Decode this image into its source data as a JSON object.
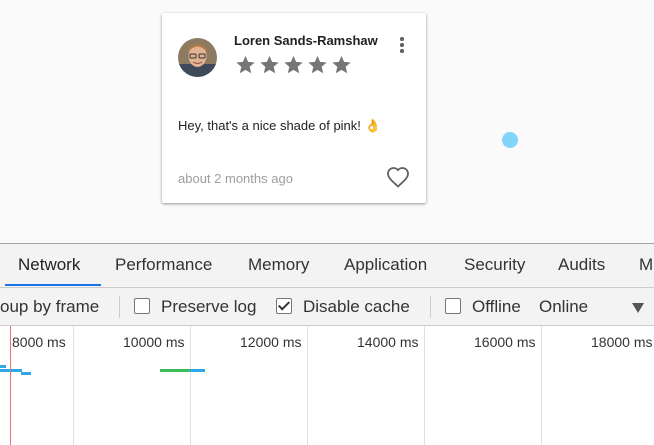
{
  "card": {
    "reviewer_name": "Loren Sands-Ramshaw",
    "rating": 5,
    "rating_max": 5,
    "review_text": "Hey, that's a nice shade of pink! 👌",
    "timestamp": "about 2 months ago",
    "star_color": "#757575"
  },
  "devtools": {
    "tabs": [
      {
        "label": "Network",
        "active": true
      },
      {
        "label": "Performance"
      },
      {
        "label": "Memory"
      },
      {
        "label": "Application"
      },
      {
        "label": "Security"
      },
      {
        "label": "Audits"
      },
      {
        "label": "M"
      }
    ],
    "toolbar": {
      "group_by_frame": "oup by frame",
      "preserve_log": {
        "label": "Preserve log",
        "checked": false
      },
      "disable_cache": {
        "label": "Disable cache",
        "checked": true
      },
      "offline": {
        "label": "Offline",
        "checked": false
      },
      "throttling": "Online"
    },
    "timeline": {
      "ticks": [
        "8000 ms",
        "10000 ms",
        "12000 ms",
        "14000 ms",
        "16000 ms",
        "18000 ms"
      ]
    }
  }
}
